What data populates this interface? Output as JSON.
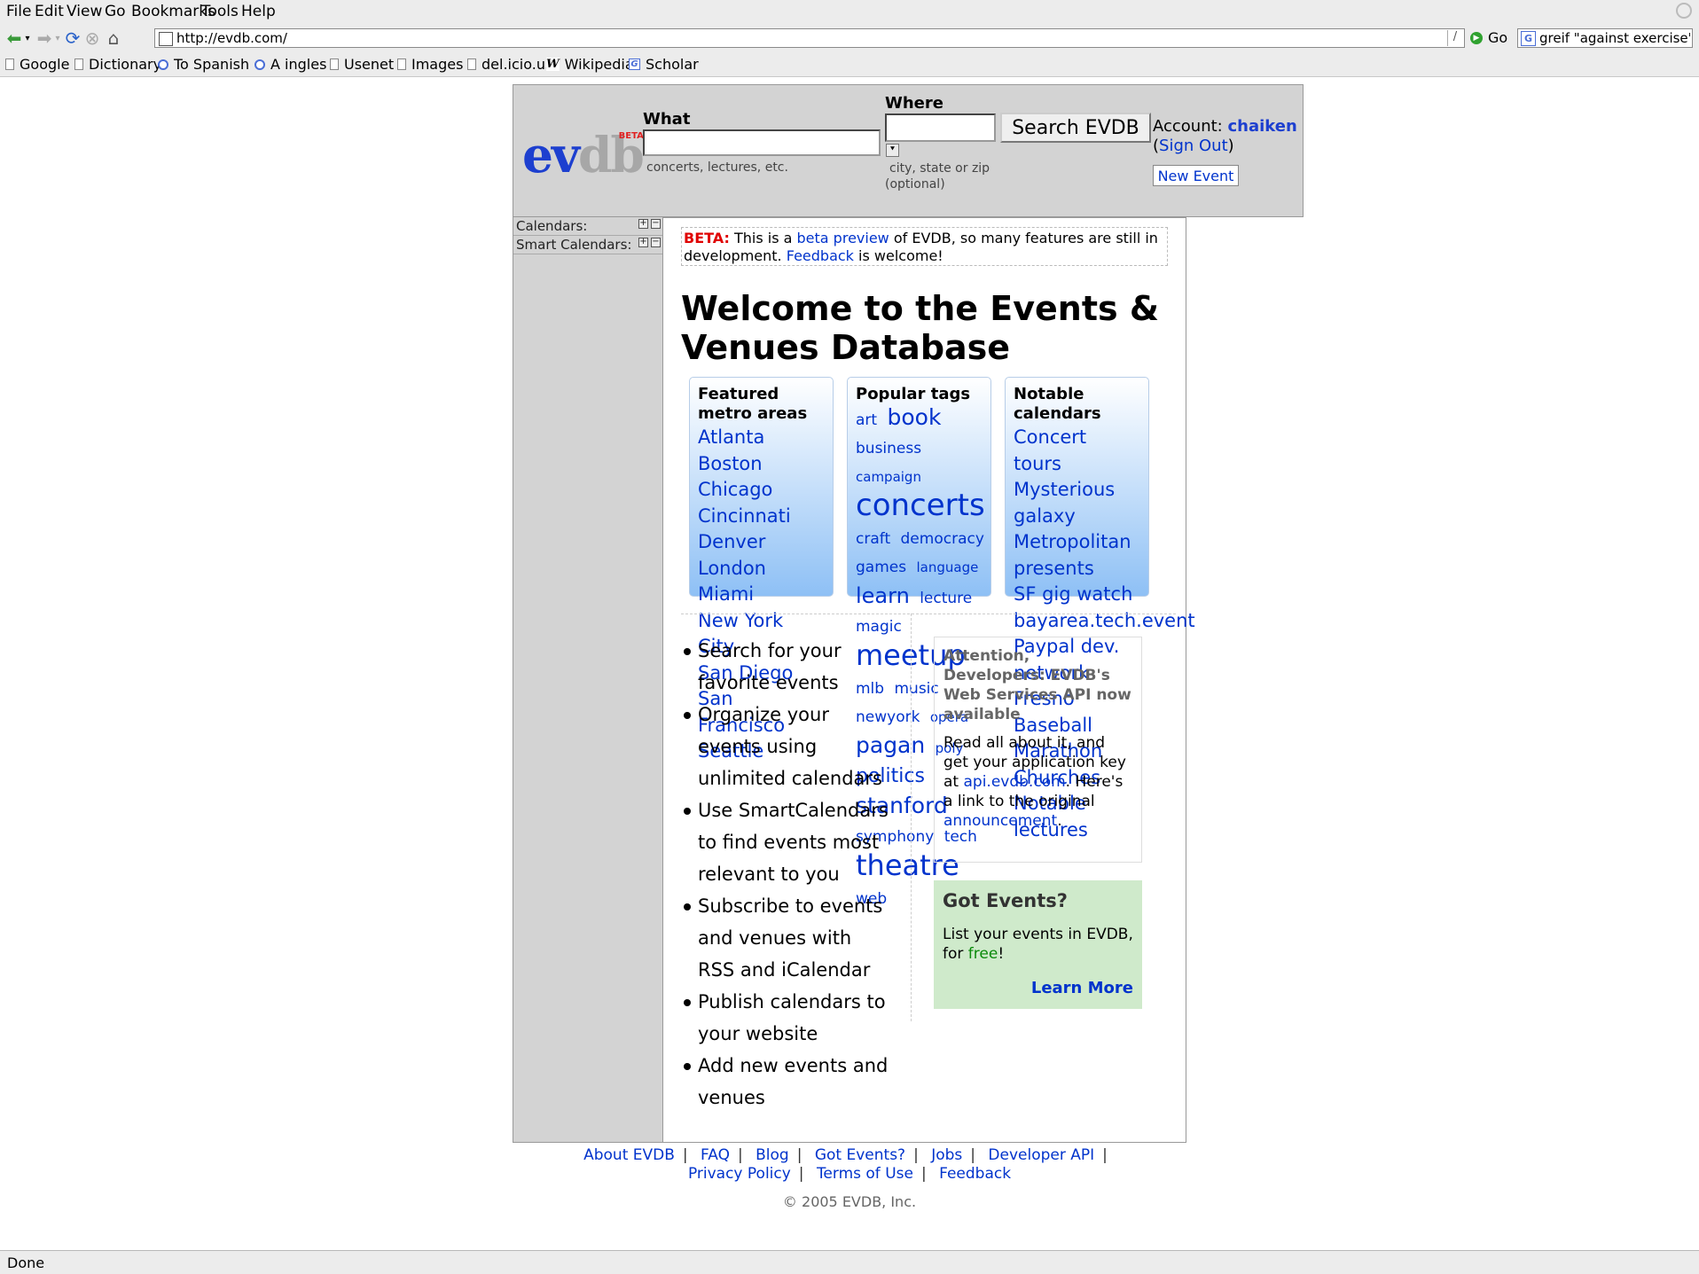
{
  "browser": {
    "menu": [
      "File",
      "Edit",
      "View",
      "Go",
      "Bookmarks",
      "Tools",
      "Help"
    ],
    "url": "http://evdb.com/",
    "go_label": "Go",
    "search_value": "greif \"against exercise\"",
    "bookmarks": [
      "Google",
      "Dictionary",
      "To Spanish",
      "A ingles",
      "Usenet",
      "Images",
      "del.icio.us",
      "Wikipedia",
      "Scholar"
    ],
    "status": "Done"
  },
  "header": {
    "logo_ev": "ev",
    "logo_db": "db",
    "logo_beta": "BETA",
    "what_label": "What",
    "what_hint": "concerts, lectures, etc.",
    "where_label": "Where",
    "where_hint_1": "city, state or zip",
    "where_hint_2": "(optional)",
    "search_button": "Search EVDB",
    "account_label": "Account:",
    "account_user": "chaiken",
    "sign_out": "Sign Out",
    "new_event": "New Event"
  },
  "sidebar": {
    "calendars": "Calendars:",
    "smart_calendars": "Smart Calendars:"
  },
  "beta_notice": {
    "tag": "BETA:",
    "text1": "This is a",
    "link1": "beta preview",
    "text2": "of EVDB, so many features are still in development.",
    "link2": "Feedback",
    "text3": "is welcome!"
  },
  "welcome": "Welcome to the Events & Venues Database",
  "metro": {
    "title": "Featured metro areas",
    "items": [
      "Atlanta",
      "Boston",
      "Chicago",
      "Cincinnati",
      "Denver",
      "London",
      "Miami",
      "New York City",
      "San Diego",
      "San Francisco",
      "Seattle"
    ]
  },
  "tags": {
    "title": "Popular tags",
    "items": [
      {
        "t": "art",
        "s": 17
      },
      {
        "t": "book",
        "s": 25
      },
      {
        "t": "business",
        "s": 17
      },
      {
        "t": "campaign",
        "s": 15
      },
      {
        "t": "concerts",
        "s": 34
      },
      {
        "t": "craft",
        "s": 17
      },
      {
        "t": "democracy",
        "s": 17
      },
      {
        "t": "games",
        "s": 17
      },
      {
        "t": "language",
        "s": 15
      },
      {
        "t": "learn",
        "s": 24
      },
      {
        "t": "lecture",
        "s": 17
      },
      {
        "t": "magic",
        "s": 17
      },
      {
        "t": "meetup",
        "s": 32
      },
      {
        "t": "mlb",
        "s": 17
      },
      {
        "t": "music",
        "s": 17
      },
      {
        "t": "newyork",
        "s": 17
      },
      {
        "t": "opera",
        "s": 15
      },
      {
        "t": "pagan",
        "s": 25
      },
      {
        "t": "poly",
        "s": 15
      },
      {
        "t": "politics",
        "s": 22
      },
      {
        "t": "stanford",
        "s": 25
      },
      {
        "t": "symphony",
        "s": 17
      },
      {
        "t": "tech",
        "s": 17
      },
      {
        "t": "theatre",
        "s": 32
      },
      {
        "t": "web",
        "s": 17
      }
    ]
  },
  "calendars": {
    "title": "Notable calendars",
    "items": [
      "Concert tours",
      "Mysterious galaxy",
      "Metropolitan presents",
      "SF gig watch",
      "bayarea.tech.event",
      "Paypal dev. network",
      "Fresno Baseball",
      "Marathon Churches",
      "Notable lectures"
    ]
  },
  "features": [
    "Search for your favorite events",
    "Organize your events using unlimited calendars",
    "Use SmartCalendars to find events most relevant to you",
    "Subscribe to events and venues with RSS and iCalendar",
    "Publish calendars to your website",
    "Add new events and venues"
  ],
  "attention": {
    "title": "Attention, Developers: EVDB's Web Services API now available",
    "t1": "Read all about it, and get your application key at",
    "link1": "api.evdb.com",
    "t2": ". Here's a link to the original",
    "link2": "announcement",
    "t3": "."
  },
  "got_events": {
    "title": "Got Events?",
    "t1": "List your events in EVDB, for",
    "free": "free",
    "t2": "!",
    "learn_more": "Learn More"
  },
  "footer": {
    "links": [
      "About EVDB",
      "FAQ",
      "Blog",
      "Got Events?",
      "Jobs",
      "Developer API",
      "Privacy Policy",
      "Terms of Use",
      "Feedback"
    ],
    "copyright": "© 2005 EVDB, Inc."
  }
}
